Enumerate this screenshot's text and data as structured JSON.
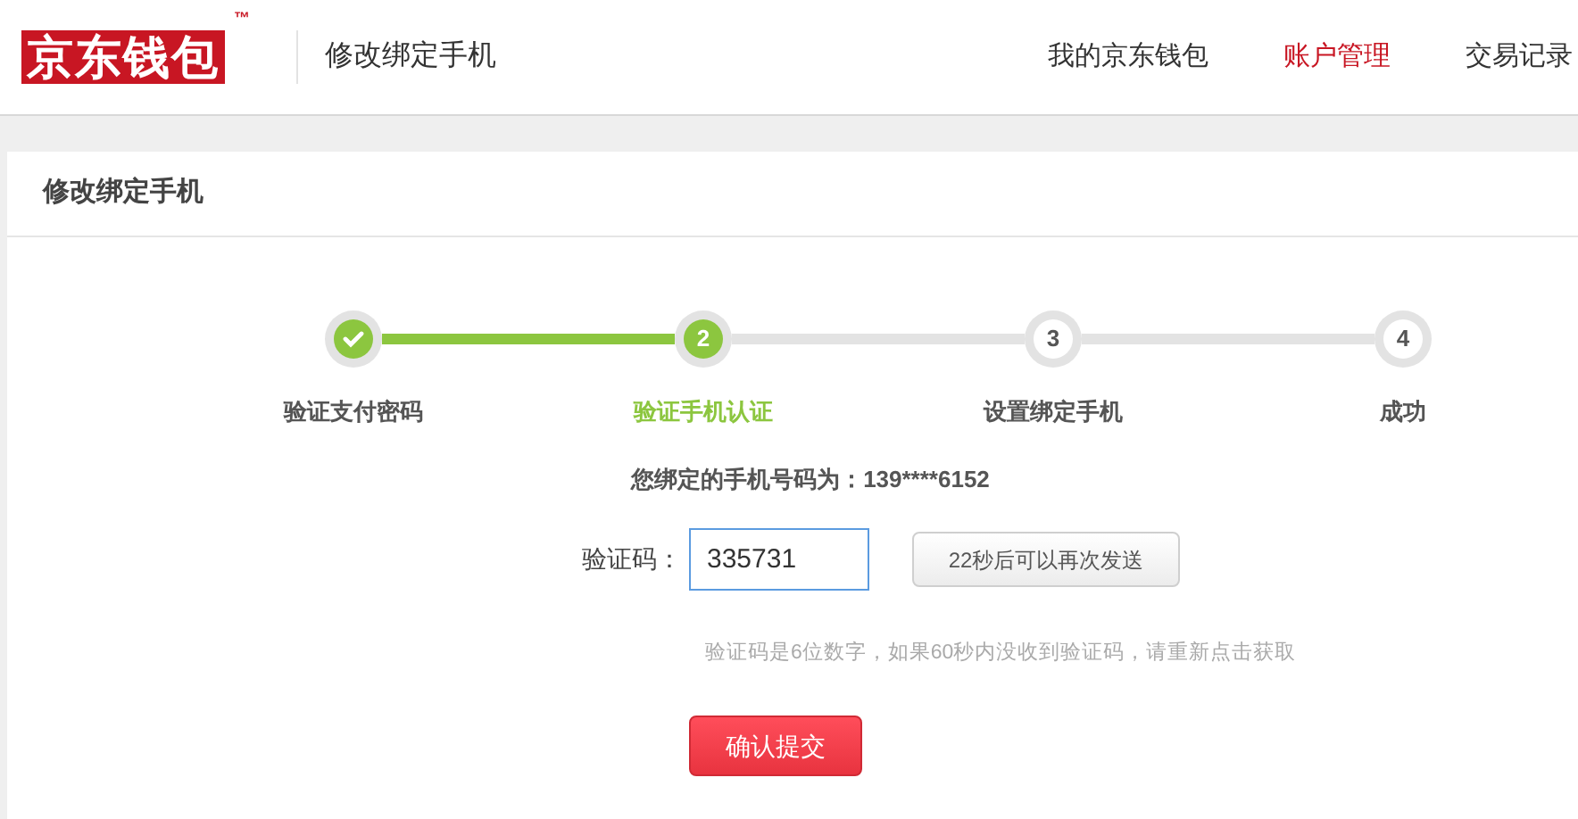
{
  "logo": {
    "text": "京东钱包",
    "mark": "™"
  },
  "header": {
    "title": "修改绑定手机"
  },
  "nav": [
    {
      "label": "我的京东钱包",
      "selected": false
    },
    {
      "label": "账户管理",
      "selected": true
    },
    {
      "label": "交易记录",
      "selected": false
    }
  ],
  "card": {
    "title": "修改绑定手机"
  },
  "steps": [
    {
      "kind": "done",
      "label": "验证支付密码"
    },
    {
      "kind": "current",
      "number": "2",
      "label": "验证手机认证"
    },
    {
      "kind": "todo",
      "number": "3",
      "label": "设置绑定手机"
    },
    {
      "kind": "todo",
      "number": "4",
      "label": "成功"
    }
  ],
  "phone_line": "您绑定的手机号码为：139****6152",
  "code_field": {
    "label": "验证码：",
    "value": "335731"
  },
  "resend_button": {
    "label": "22秒后可以再次发送",
    "disabled": true
  },
  "hint": "验证码是6位数字，如果60秒内没收到验证码，请重新点击获取",
  "submit_button": {
    "label": "确认提交"
  }
}
